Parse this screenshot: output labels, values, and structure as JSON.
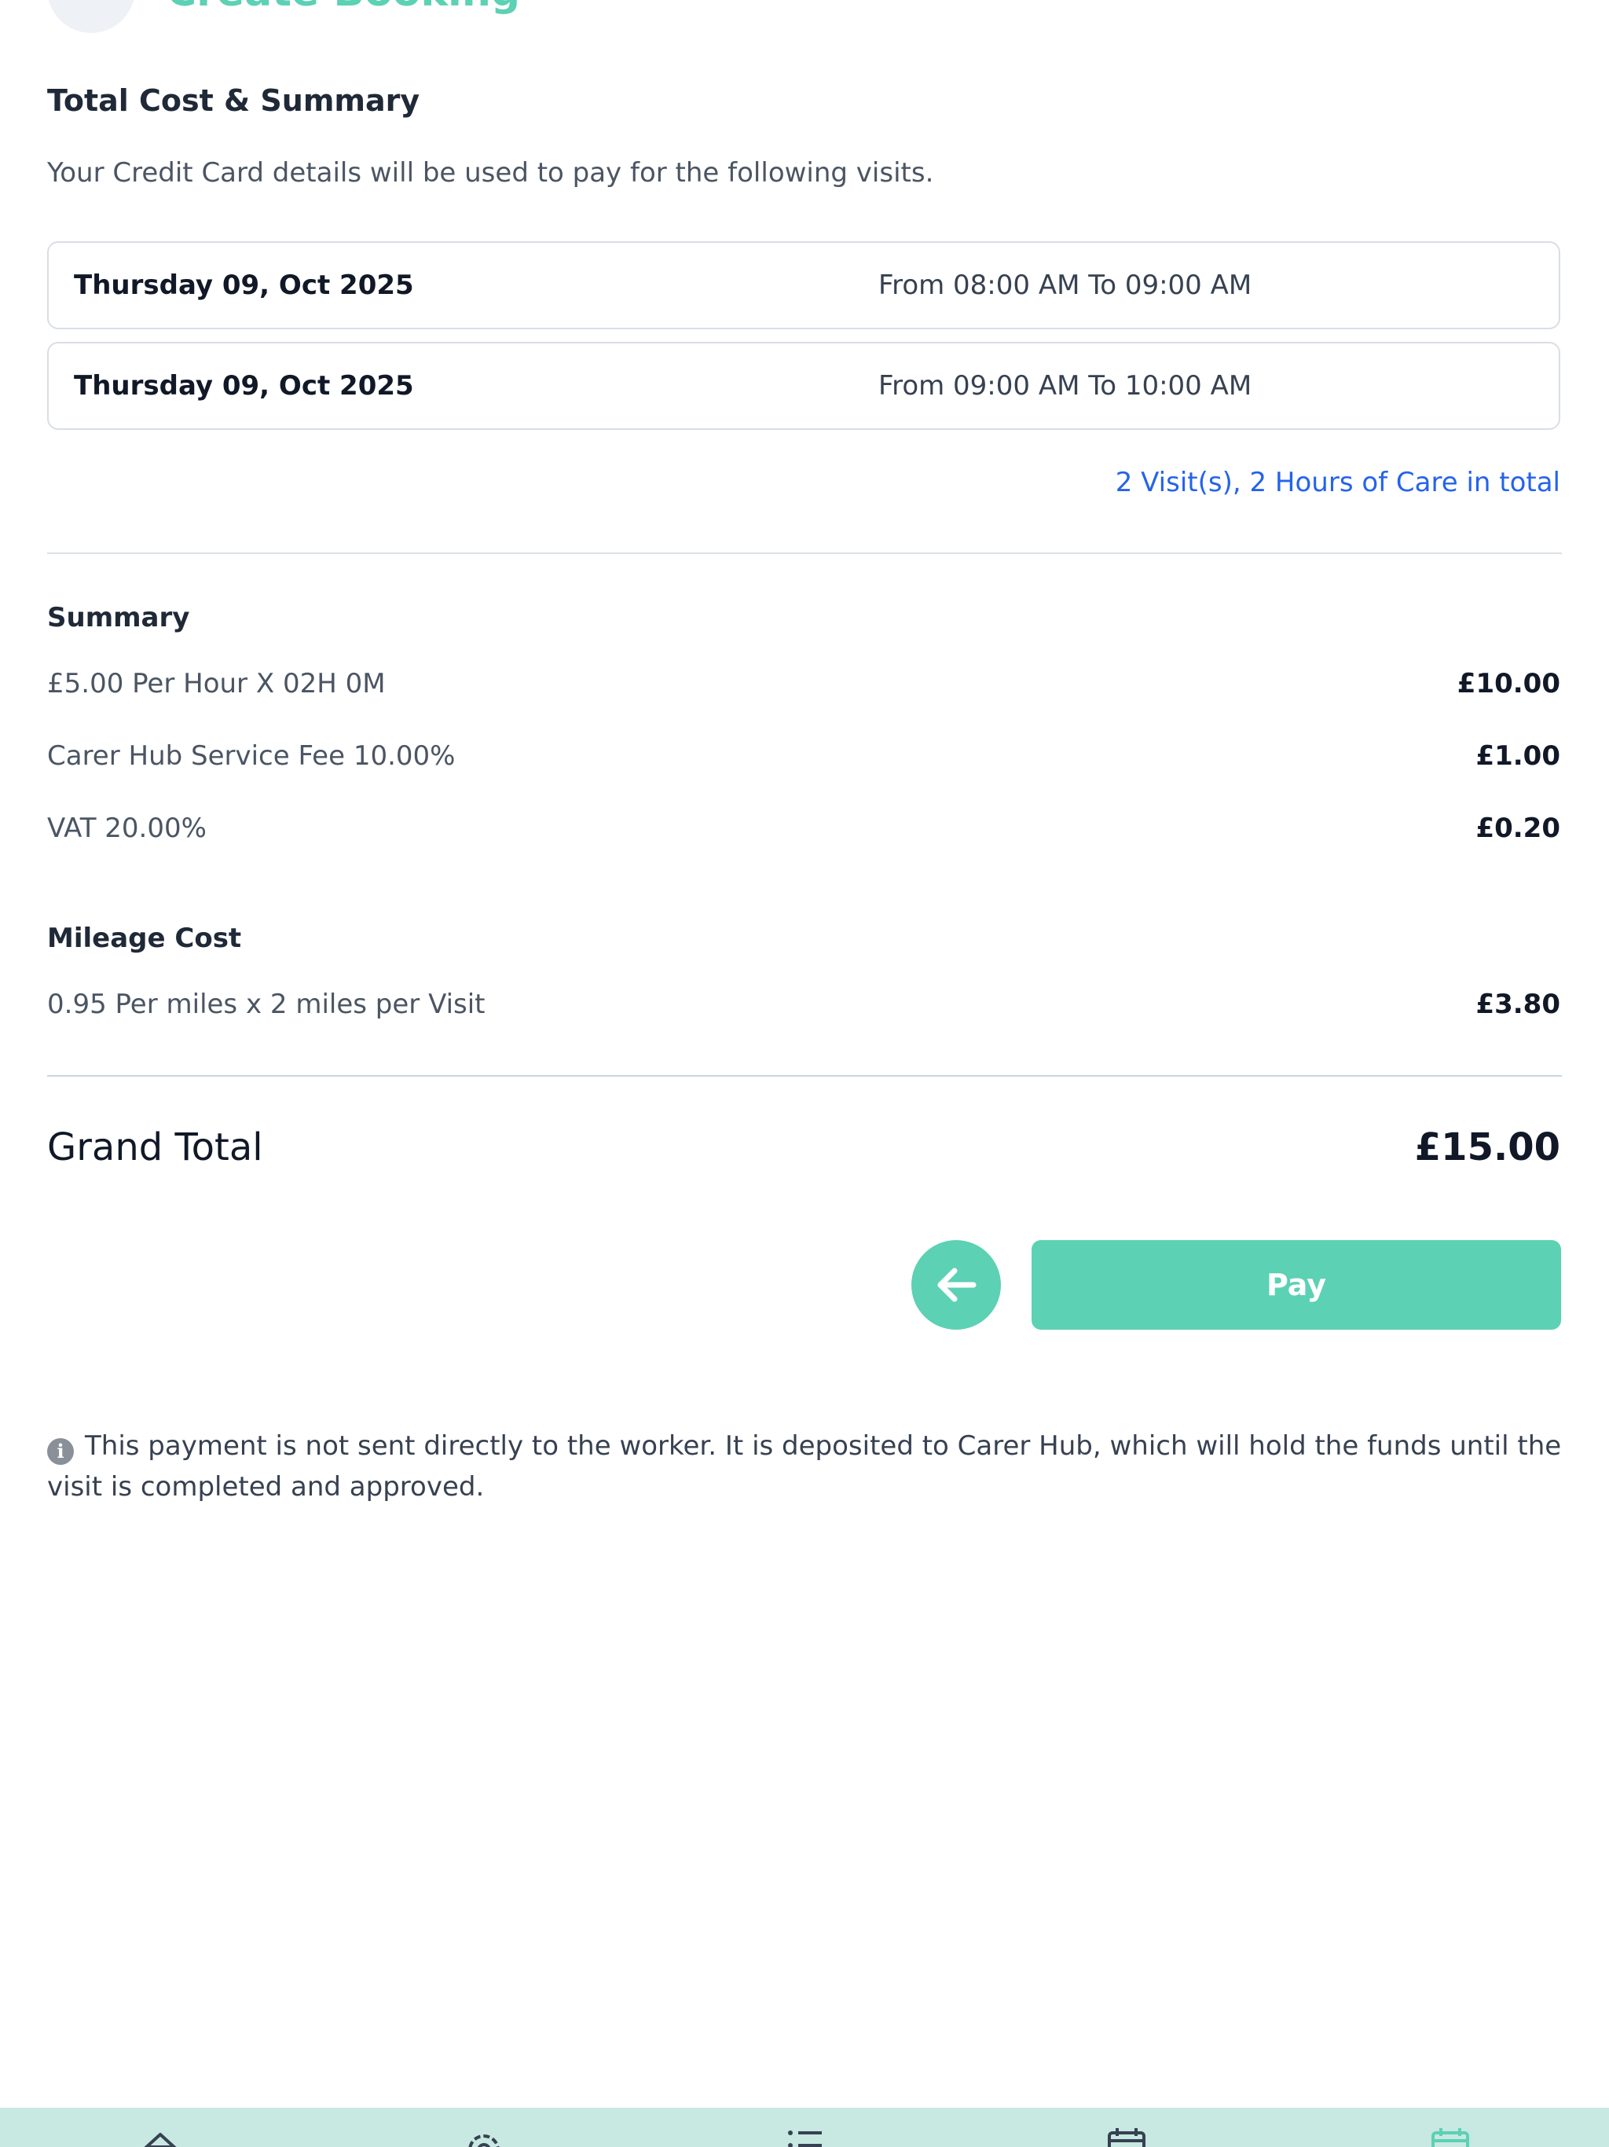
{
  "header": {
    "title": "Create Booking"
  },
  "summary_section": {
    "title": "Total Cost & Summary",
    "intro": "Your Credit Card details will be used to pay for the following visits."
  },
  "visits": [
    {
      "date": "Thursday 09, Oct 2025",
      "time": "From 08:00 AM To 09:00 AM"
    },
    {
      "date": "Thursday 09, Oct 2025",
      "time": "From 09:00 AM To 10:00 AM"
    }
  ],
  "visits_total": "2 Visit(s), 2 Hours of Care in total",
  "summary": {
    "heading": "Summary",
    "rows": [
      {
        "label": "£5.00 Per Hour X 02H 0M",
        "value": "£10.00"
      },
      {
        "label": "Carer Hub Service Fee 10.00%",
        "value": "£1.00"
      },
      {
        "label": "VAT 20.00%",
        "value": "£0.20"
      }
    ]
  },
  "mileage": {
    "heading": "Mileage Cost",
    "label": "0.95 Per miles x 2 miles per Visit",
    "value": "£3.80"
  },
  "grand_total": {
    "label": "Grand Total",
    "value": "£15.00"
  },
  "actions": {
    "pay_label": "Pay",
    "back_icon": "arrow-left-icon"
  },
  "note": {
    "icon": "info-icon",
    "text": "This payment is not sent directly to the worker. It is deposited to Carer Hub, which will hold the funds until the visit is completed and approved."
  },
  "tabbar": {
    "icons": [
      "home-icon",
      "gear-icon",
      "list-icon",
      "calendar-icon",
      "calendar-active-icon"
    ]
  },
  "colors": {
    "accent": "#5cd1b4",
    "link": "#2563eb",
    "tabbar_bg": "#c8e8e2"
  }
}
